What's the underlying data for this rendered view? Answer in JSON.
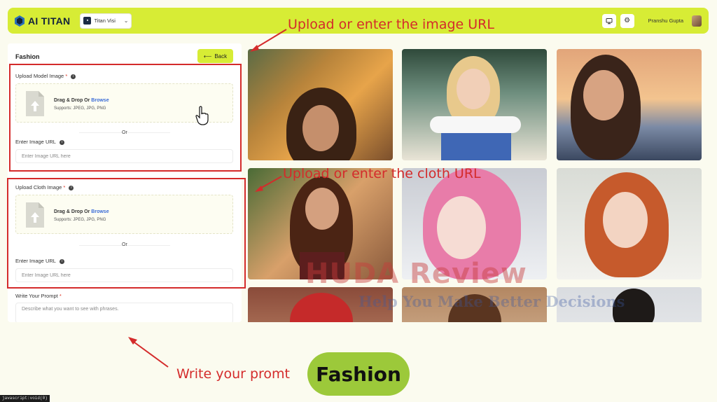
{
  "header": {
    "logo_text": "AI TITAN",
    "workspace": "Titan Visi",
    "user_name": "Pranshu Gupta",
    "icons": [
      "logo-icon",
      "monitor-icon",
      "settings-icon",
      "avatar"
    ]
  },
  "panel": {
    "title": "Fashion",
    "back_label": "Back",
    "model": {
      "label": "Upload Model Image",
      "required": "*",
      "drop_text": "Drag & Drop Or",
      "browse": "Browse",
      "supports": "Supports: JPEG, JPG, PNG",
      "or": "Or",
      "url_label": "Enter Image URL",
      "url_placeholder": "Enter Image URL here"
    },
    "cloth": {
      "label": "Upload Cloth Image",
      "required": "*",
      "drop_text": "Drag & Drop Or",
      "browse": "Browse",
      "supports": "Supports: JPEG, JPG, PNG",
      "or": "Or",
      "url_label": "Enter Image URL",
      "url_placeholder": "Enter Image URL here"
    },
    "prompt": {
      "label": "Write Your Prompt",
      "required": "*",
      "placeholder": "Describe what you want to see with phrases."
    }
  },
  "annotations": {
    "image_url": "Upload or enter the image URL",
    "cloth_url": "Upload or enter the cloth URL",
    "prompt": "Write your promt",
    "badge": "Fashion"
  },
  "watermark": {
    "line1": "HUDA Review",
    "line2": "Help You Make Better Decisions"
  },
  "status_bar": "javascript:void(0)",
  "colors": {
    "accent": "#d7ec35",
    "annotation_red": "#d42b2b",
    "badge_green": "#9cc93a",
    "page_bg": "#fbfbef"
  }
}
